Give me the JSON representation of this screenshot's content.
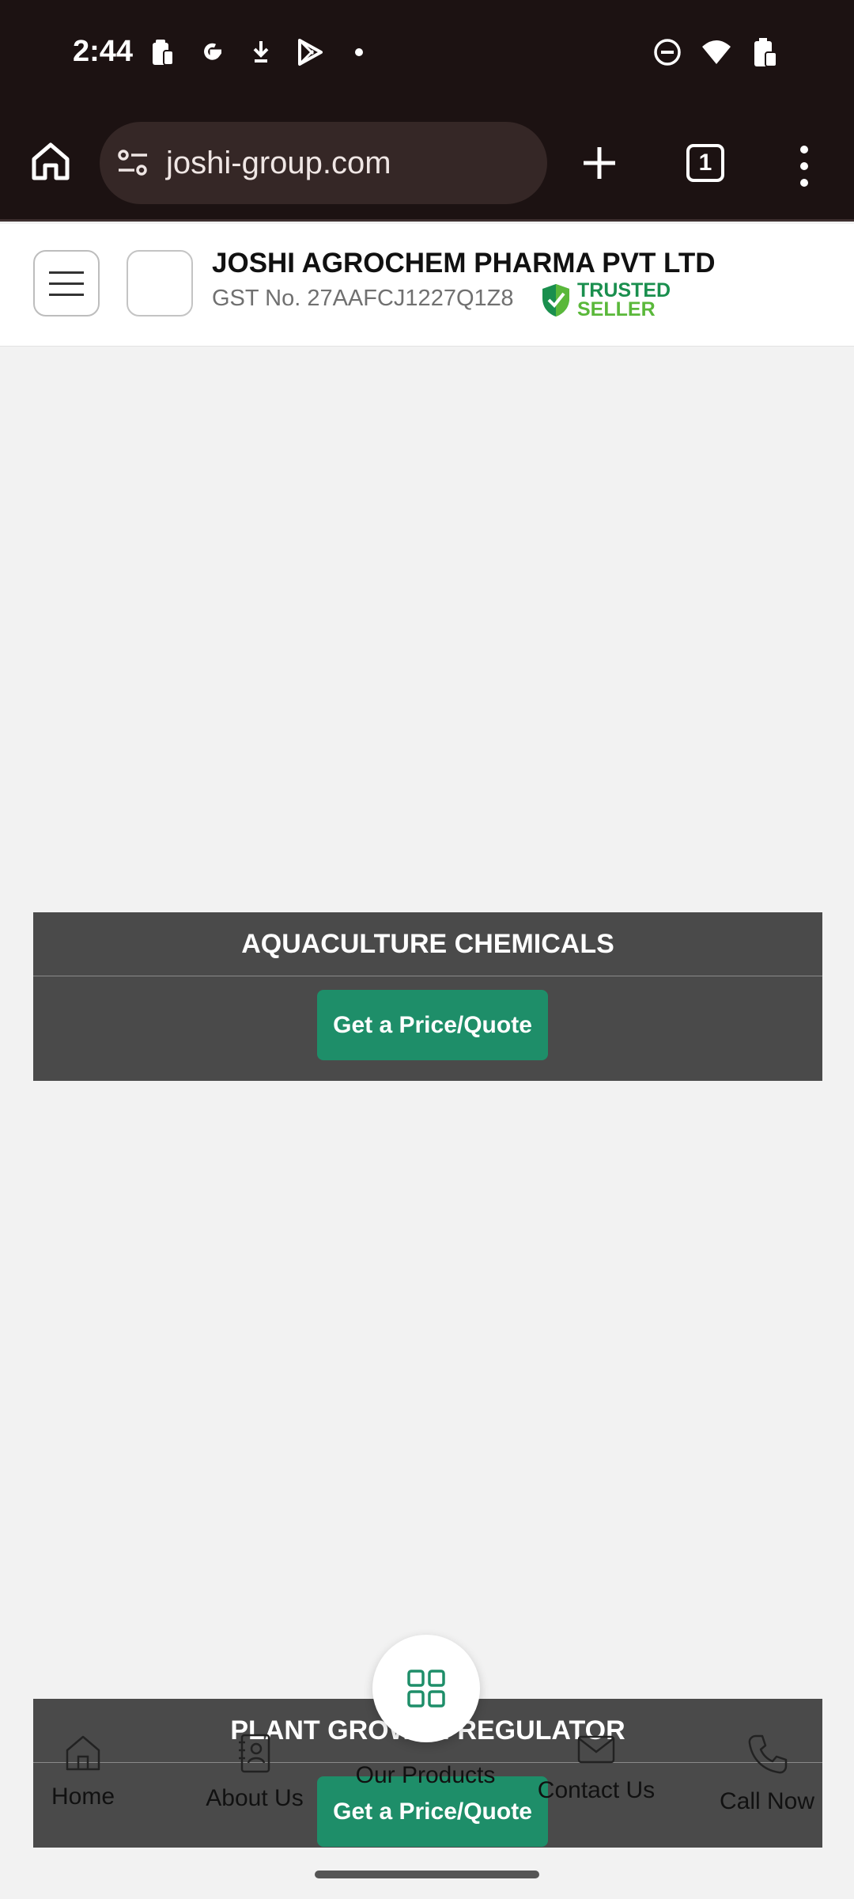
{
  "status_bar": {
    "time": "2:44",
    "left_icons": [
      "clipboard-icon",
      "google-icon",
      "download-icon",
      "play-store-icon",
      "dot-icon"
    ],
    "right_icons": [
      "dnd-icon",
      "wifi-icon",
      "battery-icon"
    ]
  },
  "browser": {
    "url": "joshi-group.com",
    "tab_count": "1"
  },
  "header": {
    "company_name": "JOSHI AGROCHEM PHARMA PVT LTD",
    "gst": "GST No. 27AAFCJ1227Q1Z8",
    "trusted_line1": "TRUSTED",
    "trusted_line2": "SELLER"
  },
  "categories": [
    {
      "title": "AQUACULTURE CHEMICALS",
      "button": "Get a Price/Quote"
    },
    {
      "title": "PLANT GROWTH REGULATOR",
      "button": "Get a Price/Quote"
    }
  ],
  "bottom_nav": {
    "home": "Home",
    "about": "About Us",
    "products": "Our Products",
    "contact": "Contact Us",
    "call": "Call Now"
  },
  "colors": {
    "accent_green": "#1e8e69",
    "browser_bg": "#1c1212",
    "category_bg": "#4a4a4a"
  }
}
